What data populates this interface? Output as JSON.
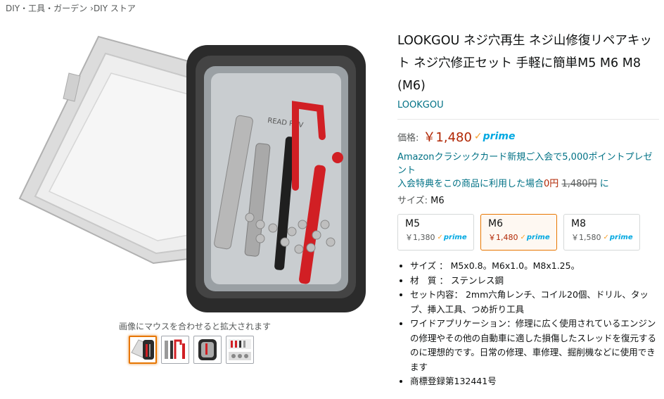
{
  "breadcrumb": [
    "DIY・工具・ガーデン",
    "DIY ストア"
  ],
  "breadcrumb_sep": "›",
  "gallery": {
    "zoom_hint": "画像にマウスを合わせると拡大されます",
    "box_label": "READ REV"
  },
  "product": {
    "title": "LOOKGOU ネジ穴再生 ネジ山修復リペアキット ネジ穴修正セット 手軽に簡単M5 M6 M8 (M6)",
    "brand": "LOOKGOU",
    "price_label": "価格:",
    "price": "￥1,480",
    "prime": "prime",
    "promo_line1": "Amazonクラシックカード新規ご入会で5,000ポイントプレゼント",
    "promo_line2_prefix": "入会特典をこの商品に利用した場合",
    "promo_zero": "0円",
    "promo_strike": "1,480円",
    "promo_suffix": "に",
    "size_label": "サイズ:",
    "size_value": "M6"
  },
  "variants": [
    {
      "name": "M5",
      "price": "￥1,380",
      "selected": false
    },
    {
      "name": "M6",
      "price": "￥1,480",
      "selected": true
    },
    {
      "name": "M8",
      "price": "￥1,580",
      "selected": false
    }
  ],
  "bullets": [
    "サイズ ： M5x0.8。M6x1.0。M8x1.25。",
    "材　質 ： ステンレス鋼",
    "セット内容： 2mm六角レンチ、コイル20個、ドリル、タップ、挿入工具、つめ折り工具",
    "ワイドアプリケーション：修理に広く使用されているエンジンの修理やその他の自動車に適した損傷したスレッドを復元するのに理想的です。日常の修理、車修理、掘削機などに使用できます",
    "商標登録第132441号"
  ],
  "colors": {
    "price": "#b12704",
    "link": "#007185",
    "prime": "#00a8e1",
    "selected_border": "#e77600"
  }
}
